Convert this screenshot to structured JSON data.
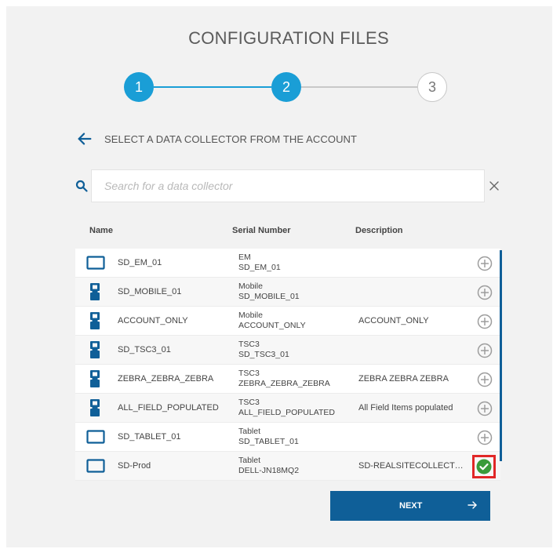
{
  "page": {
    "title": "CONFIGURATION FILES"
  },
  "stepper": {
    "steps": [
      {
        "label": "1",
        "state": "done"
      },
      {
        "label": "2",
        "state": "current"
      },
      {
        "label": "3",
        "state": "todo"
      }
    ]
  },
  "subheader": {
    "back_icon": "arrow-left-icon",
    "label": "SELECT A DATA COLLECTOR FROM THE ACCOUNT"
  },
  "search": {
    "placeholder": "Search for a data collector",
    "value": ""
  },
  "table": {
    "columns": [
      "Name",
      "Serial Number",
      "Description"
    ],
    "rows": [
      {
        "icon": "tablet-icon",
        "name": "SD_EM_01",
        "serial_model": "EM",
        "serial": "SD_EM_01",
        "description": "",
        "selected": false
      },
      {
        "icon": "handheld-icon",
        "name": "SD_MOBILE_01",
        "serial_model": "Mobile",
        "serial": "SD_MOBILE_01",
        "description": "",
        "selected": false
      },
      {
        "icon": "handheld-icon",
        "name": "ACCOUNT_ONLY",
        "serial_model": "Mobile",
        "serial": "ACCOUNT_ONLY",
        "description": "ACCOUNT_ONLY",
        "selected": false
      },
      {
        "icon": "handheld-icon",
        "name": "SD_TSC3_01",
        "serial_model": "TSC3",
        "serial": "SD_TSC3_01",
        "description": "",
        "selected": false
      },
      {
        "icon": "handheld-icon",
        "name": "ZEBRA_ZEBRA_ZEBRA",
        "serial_model": "TSC3",
        "serial": "ZEBRA_ZEBRA_ZEBRA",
        "description": "ZEBRA ZEBRA ZEBRA",
        "selected": false
      },
      {
        "icon": "handheld-icon",
        "name": "ALL_FIELD_POPULATED",
        "serial_model": "TSC3",
        "serial": "ALL_FIELD_POPULATED",
        "description": "All Field Items populated",
        "selected": false
      },
      {
        "icon": "tablet-icon",
        "name": "SD_TABLET_01",
        "serial_model": "Tablet",
        "serial": "SD_TABLET_01",
        "description": "",
        "selected": false
      },
      {
        "icon": "tablet-icon",
        "name": "SD-Prod",
        "serial_model": "Tablet",
        "serial": "DELL-JN18MQ2",
        "description": "SD-REALSITECOLLECTOR-...",
        "selected": true
      }
    ]
  },
  "actions": {
    "next_label": "NEXT"
  },
  "colors": {
    "accent": "#1a9ed6",
    "primary": "#0f5f98",
    "selected": "#3a9b3a",
    "highlight": "#e12727"
  }
}
